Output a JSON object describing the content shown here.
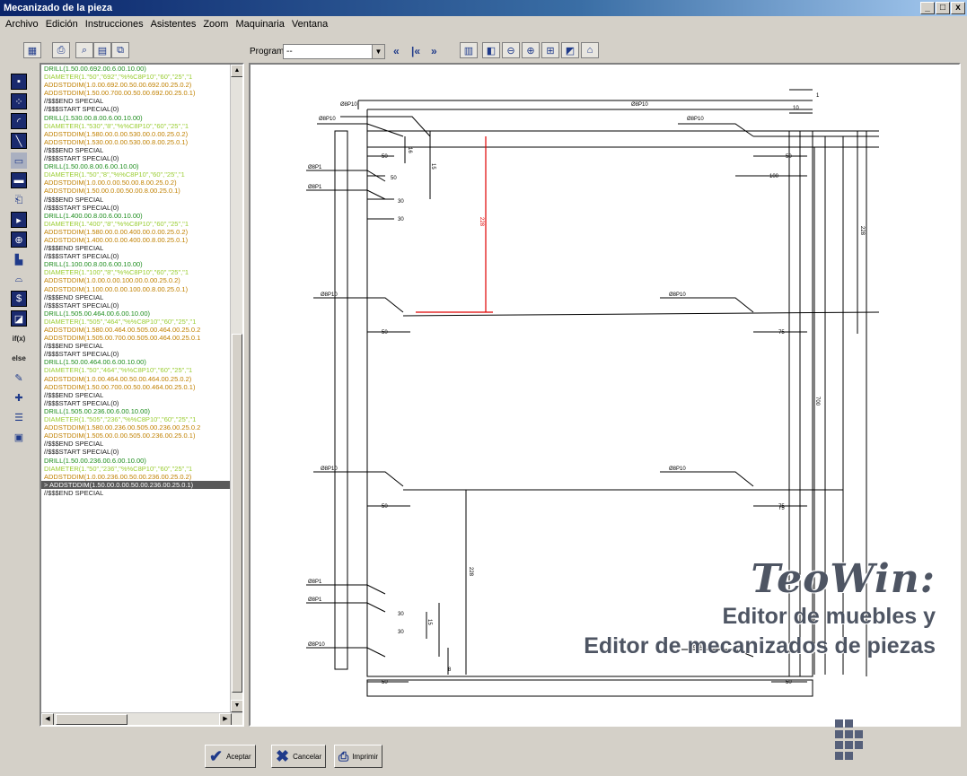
{
  "window": {
    "title": "Mecanizado de la pieza",
    "buttons": [
      "_",
      "□",
      "x"
    ]
  },
  "menu": {
    "items": [
      "Archivo",
      "Edición",
      "Instrucciones",
      "Asistentes",
      "Zoom",
      "Maquinaria",
      "Ventana"
    ]
  },
  "toolbar": {
    "programa_label": "Programa",
    "programa_value": "--",
    "left_icons": [
      "grid-icon",
      "export-icon",
      "print-preview-icon",
      "machine-icon",
      "copy-icon"
    ],
    "nav_buttons": [
      "«",
      "|«",
      "»"
    ],
    "right_icons": [
      "layout-icon",
      "view-icon",
      "zoom-out-icon",
      "zoom-fit-icon",
      "zoom-window-icon",
      "view-back-icon",
      "view-home-icon"
    ]
  },
  "left_tools": [
    "point-tool-icon",
    "drill-tool-icon",
    "corner-tool-icon",
    "line-tool-icon",
    "pocket-tool-icon",
    "rect-tool-icon",
    "groove-tool-icon",
    "move-tool-icon",
    "target-tool-icon",
    "edit-tool-icon",
    "arc-tool-icon",
    "variable-tool-icon",
    "image-tool-icon",
    "if-tool",
    "else-tool",
    "pencil-tool-icon",
    "add-tool-icon",
    "list-tool-icon",
    "stack-tool-icon"
  ],
  "left_tool_text": {
    "if": "if(x)",
    "else": "else"
  },
  "code_lines": [
    {
      "t": "DRILL(1.50.00.692.00.6.00.10.00)",
      "k": "drill"
    },
    {
      "t": "DIAMETER(1.\"50\",\"692\",\"%%C8P10\",\"60\",\"25\",\"1",
      "k": "diam"
    },
    {
      "t": "ADDSTDDIM(1.0.00.692.00.50.00.692.00.25.0.2)",
      "k": "adds"
    },
    {
      "t": "ADDSTDDIM(1.50.00.700.00.50.00.692.00.25.0.1)",
      "k": "adds"
    },
    {
      "t": "//$$$END SPECIAL",
      "k": "spec"
    },
    {
      "t": "//$$$START SPECIAL(0)",
      "k": "spec"
    },
    {
      "t": "DRILL(1.530.00.8.00.6.00.10.00)",
      "k": "drill"
    },
    {
      "t": "DIAMETER(1.\"530\",\"8\",\"%%C8P10\",\"60\",\"25\",\"1",
      "k": "diam"
    },
    {
      "t": "ADDSTDDIM(1.580.00.0.00.530.00.0.00.25.0.2)",
      "k": "adds"
    },
    {
      "t": "ADDSTDDIM(1.530.00.0.00.530.00.8.00.25.0.1)",
      "k": "adds"
    },
    {
      "t": "//$$$END SPECIAL",
      "k": "spec"
    },
    {
      "t": "//$$$START SPECIAL(0)",
      "k": "spec"
    },
    {
      "t": "DRILL(1.50.00.8.00.6.00.10.00)",
      "k": "drill"
    },
    {
      "t": "DIAMETER(1.\"50\",\"8\",\"%%C8P10\",\"60\",\"25\",\"1",
      "k": "diam"
    },
    {
      "t": "ADDSTDDIM(1.0.00.0.00.50.00.8.00.25.0.2)",
      "k": "adds"
    },
    {
      "t": "ADDSTDDIM(1.50.00.0.00.50.00.8.00.25.0.1)",
      "k": "adds"
    },
    {
      "t": "//$$$END SPECIAL",
      "k": "spec"
    },
    {
      "t": "//$$$START SPECIAL(0)",
      "k": "spec"
    },
    {
      "t": "DRILL(1.400.00.8.00.6.00.10.00)",
      "k": "drill"
    },
    {
      "t": "DIAMETER(1.\"400\",\"8\",\"%%C8P10\",\"60\",\"25\",\"1",
      "k": "diam"
    },
    {
      "t": "ADDSTDDIM(1.580.00.0.00.400.00.0.00.25.0.2)",
      "k": "adds"
    },
    {
      "t": "ADDSTDDIM(1.400.00.0.00.400.00.8.00.25.0.1)",
      "k": "adds"
    },
    {
      "t": "//$$$END SPECIAL",
      "k": "spec"
    },
    {
      "t": "//$$$START SPECIAL(0)",
      "k": "spec"
    },
    {
      "t": "DRILL(1.100.00.8.00.6.00.10.00)",
      "k": "drill"
    },
    {
      "t": "DIAMETER(1.\"100\",\"8\",\"%%C8P10\",\"60\",\"25\",\"1",
      "k": "diam"
    },
    {
      "t": "ADDSTDDIM(1.0.00.0.00.100.00.0.00.25.0.2)",
      "k": "adds"
    },
    {
      "t": "ADDSTDDIM(1.100.00.0.00.100.00.8.00.25.0.1)",
      "k": "adds"
    },
    {
      "t": "//$$$END SPECIAL",
      "k": "spec"
    },
    {
      "t": "//$$$START SPECIAL(0)",
      "k": "spec"
    },
    {
      "t": "DRILL(1.505.00.464.00.6.00.10.00)",
      "k": "drill"
    },
    {
      "t": "DIAMETER(1.\"505\",\"464\",\"%%C8P10\",\"60\",\"25\",\"1",
      "k": "diam"
    },
    {
      "t": "ADDSTDDIM(1.580.00.464.00.505.00.464.00.25.0.2",
      "k": "adds"
    },
    {
      "t": "ADDSTDDIM(1.505.00.700.00.505.00.464.00.25.0.1",
      "k": "adds"
    },
    {
      "t": "//$$$END SPECIAL",
      "k": "spec"
    },
    {
      "t": "//$$$START SPECIAL(0)",
      "k": "spec"
    },
    {
      "t": "DRILL(1.50.00.464.00.6.00.10.00)",
      "k": "drill"
    },
    {
      "t": "DIAMETER(1.\"50\",\"464\",\"%%C8P10\",\"60\",\"25\",\"1",
      "k": "diam"
    },
    {
      "t": "ADDSTDDIM(1.0.00.464.00.50.00.464.00.25.0.2)",
      "k": "adds"
    },
    {
      "t": "ADDSTDDIM(1.50.00.700.00.50.00.464.00.25.0.1)",
      "k": "adds"
    },
    {
      "t": "//$$$END SPECIAL",
      "k": "spec"
    },
    {
      "t": "//$$$START SPECIAL(0)",
      "k": "spec"
    },
    {
      "t": "DRILL(1.505.00.236.00.6.00.10.00)",
      "k": "drill"
    },
    {
      "t": "DIAMETER(1.\"505\",\"236\",\"%%C8P10\",\"60\",\"25\",\"1",
      "k": "diam"
    },
    {
      "t": "ADDSTDDIM(1.580.00.236.00.505.00.236.00.25.0.2",
      "k": "adds"
    },
    {
      "t": "ADDSTDDIM(1.505.00.0.00.505.00.236.00.25.0.1)",
      "k": "adds"
    },
    {
      "t": "//$$$END SPECIAL",
      "k": "spec"
    },
    {
      "t": "//$$$START SPECIAL(0)",
      "k": "spec"
    },
    {
      "t": "DRILL(1.50.00.236.00.6.00.10.00)",
      "k": "drill"
    },
    {
      "t": "DIAMETER(1.\"50\",\"236\",\"%%C8P10\",\"60\",\"25\",\"1",
      "k": "diam"
    },
    {
      "t": "ADDSTDDIM(1.0.00.236.00.50.00.236.00.25.0.2)",
      "k": "adds"
    },
    {
      "t": "> ADDSTDDIM(1.50.00.0.00.50.00.236.00.25.0.1)",
      "k": "sel"
    },
    {
      "t": "//$$$END SPECIAL",
      "k": "spec"
    }
  ],
  "drawing": {
    "drill_labels": [
      "Ø8P10",
      "Ø8P10",
      "Ø8P10",
      "Ø8P1",
      "Ø8P1",
      "Ø8P10",
      "Ø8P10",
      "Ø8P10",
      "Ø8P10",
      "Ø8P1",
      "Ø8P1",
      "Ø8P10",
      "Ø8P10",
      "Ø8P10"
    ],
    "dims": [
      "50",
      "50",
      "100",
      "30",
      "30",
      "50",
      "75",
      "50",
      "75",
      "50",
      "30",
      "30",
      "50",
      "50",
      "75",
      "228",
      "228",
      "228",
      "700",
      "1",
      "10",
      "15",
      "16",
      "15",
      "8"
    ]
  },
  "brand": {
    "name": "TeoWin:",
    "line1": "Editor de muebles  y",
    "line2": "Editor de mecanizados de piezas"
  },
  "buttons": {
    "accept": "Aceptar",
    "cancel": "Cancelar",
    "print": "Imprimir"
  }
}
